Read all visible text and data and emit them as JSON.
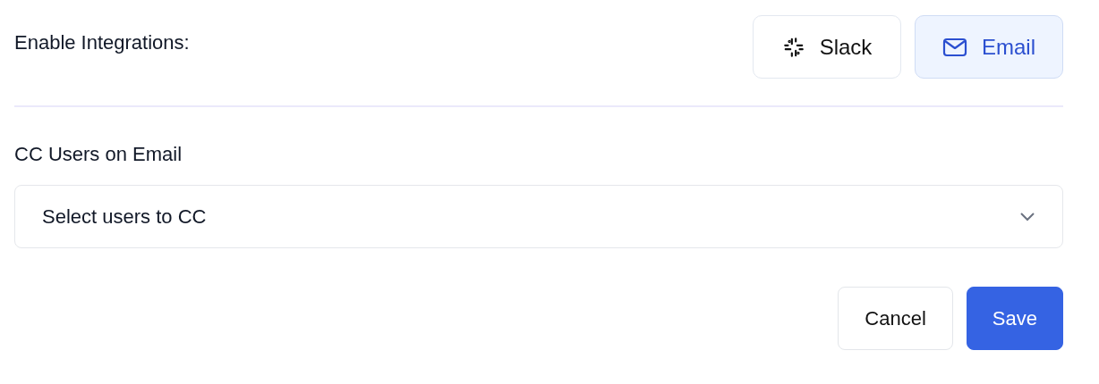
{
  "integrations": {
    "label": "Enable Integrations:",
    "options": [
      {
        "kind": "slack",
        "label": "Slack",
        "selected": false
      },
      {
        "kind": "email",
        "label": "Email",
        "selected": true
      }
    ]
  },
  "cc": {
    "label": "CC Users on Email",
    "placeholder": "Select users to CC"
  },
  "buttons": [
    {
      "kind": "secondary",
      "label": "Cancel"
    },
    {
      "kind": "primary",
      "label": "Save"
    }
  ]
}
